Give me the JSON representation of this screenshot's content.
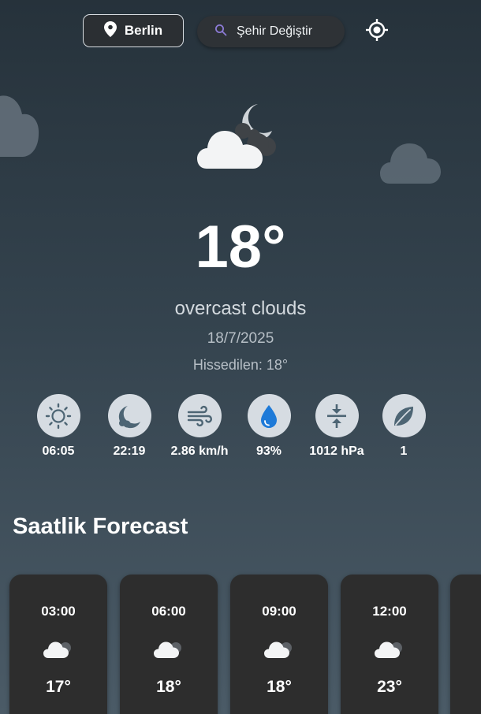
{
  "header": {
    "city": "Berlin",
    "search_label": "Şehir Değiştir"
  },
  "current": {
    "temp": "18°",
    "description": "overcast clouds",
    "date": "18/7/2025",
    "feels_like": "Hissedilen: 18°",
    "icon": "cloud-moon-icon"
  },
  "stats": [
    {
      "icon": "sunrise-sun-icon",
      "value": "06:05"
    },
    {
      "icon": "sunset-moon-icon",
      "value": "22:19"
    },
    {
      "icon": "wind-icon",
      "value": "2.86 km/h"
    },
    {
      "icon": "humidity-drop-icon",
      "value": "93%"
    },
    {
      "icon": "pressure-icon",
      "value": "1012 hPa"
    },
    {
      "icon": "leaf-icon",
      "value": "1"
    }
  ],
  "hourly": {
    "title": "Saatlik Forecast",
    "items": [
      {
        "time": "03:00",
        "temp": "17°",
        "icon": "cloud-icon"
      },
      {
        "time": "06:00",
        "temp": "18°",
        "icon": "cloud-icon"
      },
      {
        "time": "09:00",
        "temp": "18°",
        "icon": "cloud-icon"
      },
      {
        "time": "12:00",
        "temp": "23°",
        "icon": "cloud-icon"
      }
    ]
  },
  "colors": {
    "icon_circle": "#d6dce2",
    "icon_slate": "#4d6574",
    "drop_blue": "#1e7ad8",
    "card_bg": "#2d2d2d"
  }
}
